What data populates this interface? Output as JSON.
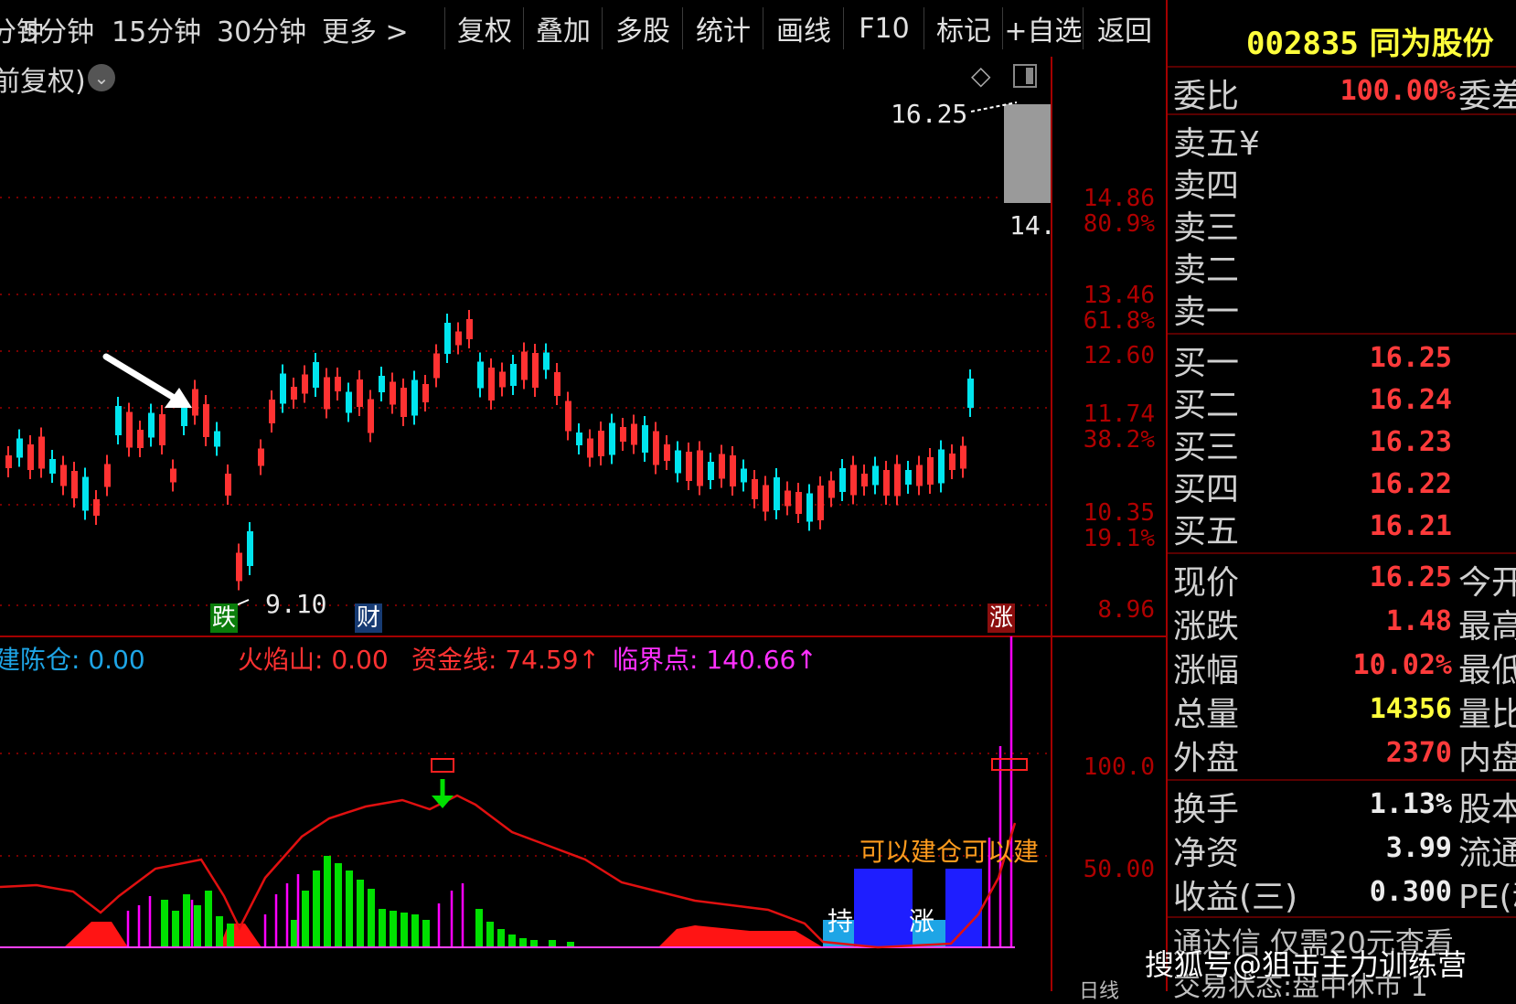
{
  "toolbar": {
    "periods": [
      "分钟",
      "5分钟",
      "15分钟",
      "30分钟"
    ],
    "more": "更多",
    "buttons": [
      "复权",
      "叠加",
      "多股",
      "统计",
      "画线",
      "F10",
      "标记",
      "+自选",
      "返回"
    ]
  },
  "chart_header": {
    "adjust_label": "前复权)"
  },
  "price_axis": {
    "labels": [
      "14.86",
      "80.9%",
      "13.46",
      "61.8%",
      "12.60",
      "11.74",
      "38.2%",
      "10.35",
      "19.1%",
      "8.96"
    ]
  },
  "annotations": {
    "high_price": "16.25",
    "high_partial": "14.",
    "low_price": "9.10",
    "marker_fall": "跌",
    "marker_finance": "财",
    "marker_rise": "涨"
  },
  "indicators": {
    "cangcang": {
      "label": "建陈仓",
      "value": "0.00"
    },
    "huoyanshan": {
      "label": "火焰山",
      "value": "0.00"
    },
    "zijinxian": {
      "label": "资金线",
      "value": "74.59"
    },
    "linjiedian": {
      "label": "临界点",
      "value": "140.66"
    },
    "arrow_up": "↑"
  },
  "indicator_axis": {
    "labels": [
      "100.0",
      "50.00"
    ]
  },
  "indicator_text": {
    "buy_signal": "可以建仓可以建",
    "hold": "持",
    "rise": "涨"
  },
  "stock": {
    "code": "002835",
    "name": "同为股份"
  },
  "quote": {
    "weibi_label": "委比",
    "weibi_value": "100.00%",
    "weicha_label": "委差",
    "sell": [
      {
        "label": "卖五",
        "price": "¥"
      },
      {
        "label": "卖四",
        "price": ""
      },
      {
        "label": "卖三",
        "price": ""
      },
      {
        "label": "卖二",
        "price": ""
      },
      {
        "label": "卖一",
        "price": ""
      }
    ],
    "buy": [
      {
        "label": "买一",
        "price": "16.25"
      },
      {
        "label": "买二",
        "price": "16.24"
      },
      {
        "label": "买三",
        "price": "16.23"
      },
      {
        "label": "买四",
        "price": "16.22"
      },
      {
        "label": "买五",
        "price": "16.21"
      }
    ],
    "stats": [
      {
        "label": "现价",
        "value": "16.25",
        "label2": "今开",
        "color": "red"
      },
      {
        "label": "涨跌",
        "value": "1.48",
        "label2": "最高",
        "color": "red"
      },
      {
        "label": "涨幅",
        "value": "10.02%",
        "label2": "最低",
        "color": "red"
      },
      {
        "label": "总量",
        "value": "14356",
        "label2": "量比",
        "color": "yel"
      },
      {
        "label": "外盘",
        "value": "2370",
        "label2": "内盘",
        "color": "red"
      }
    ],
    "stats2": [
      {
        "label": "换手",
        "value": "1.13%",
        "label2": "股本"
      },
      {
        "label": "净资",
        "value": "3.99",
        "label2": "流通"
      },
      {
        "label": "收益(三)",
        "value": "0.300",
        "label2": "PE(动"
      }
    ],
    "bottom_text": "通达信 仅需20元查看",
    "bottom_text2": "交易状态:盘中休市 1"
  },
  "watermark": "搜狐号@狙击主力训练营",
  "bottom_axis_partial": "日线",
  "colors": {
    "rise": "#ff3232",
    "fall": "#00e5ee",
    "grid": "#a00000",
    "volume_green": "#00e000",
    "volume_magenta": "#ff00ff",
    "signal_blue": "#1e1eff",
    "signal_cyan": "#1ea5e6",
    "fund_line": "#e01010",
    "label_orange": "#ff9c1e"
  }
}
